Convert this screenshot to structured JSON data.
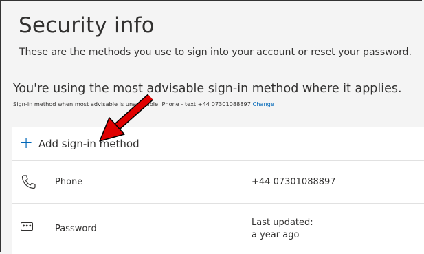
{
  "header": {
    "title": "Security info",
    "description": "These are the methods you use to sign into your account or reset your password."
  },
  "status": {
    "advisable_text": "You're using the most advisable sign-in method where it applies.",
    "fallback_text": "Sign-in method when most advisable is unavailable: Phone - text +44 07301088897",
    "change_link": "Change"
  },
  "add_method": {
    "icon": "plus-icon",
    "label": "Add sign-in method"
  },
  "methods": [
    {
      "icon": "phone-icon",
      "name": "Phone",
      "value": "+44 07301088897"
    },
    {
      "icon": "password-icon",
      "name": "Password",
      "value_line1": "Last updated:",
      "value_line2": "a year ago"
    }
  ],
  "colors": {
    "accent": "#0067b8",
    "annotation_arrow": "#e00000",
    "background": "#f4f4f4",
    "card": "#ffffff"
  }
}
